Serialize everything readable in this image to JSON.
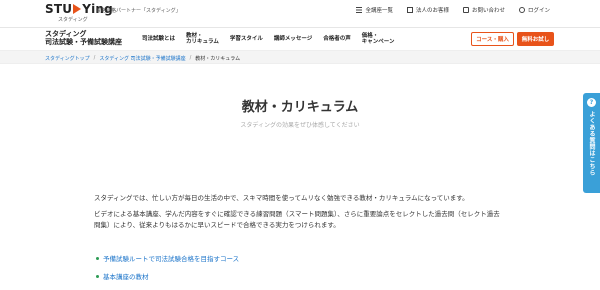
{
  "header": {
    "logo": "STUDYing",
    "logo_sub": "スタディング",
    "tagline": "資格合格パートナー「スタディング」",
    "links": [
      {
        "label": "全講座一覧",
        "icon": "menu-icon"
      },
      {
        "label": "法人のお客様",
        "icon": "building-icon"
      },
      {
        "label": "お問い合わせ",
        "icon": "mail-icon"
      },
      {
        "label": "ログイン",
        "icon": "user-icon"
      }
    ]
  },
  "nav": {
    "brand_line1": "スタディング",
    "brand_line2": "司法試験・予備試験講座",
    "items": [
      "司法試験とは",
      "教材・\nカリキュラム",
      "学習スタイル",
      "講師メッセージ",
      "合格者の声",
      "価格・\nキャンペーン"
    ],
    "course_button": "コース・購入",
    "free_button": "無料お試し"
  },
  "breadcrumb": {
    "items": [
      "スタディングトップ",
      "スタディング 司法試験・予備試験講座",
      "教材・カリキュラム"
    ]
  },
  "hero": {
    "title": "教材・カリキュラム",
    "subtitle": "スタディングの効果をぜひ体感してください"
  },
  "body": {
    "para1": "スタディングでは、忙しい方が毎日の生活の中で、スキマ時間を使ってムリなく勉強できる教材・カリキュラムになっています。",
    "para2": "ビデオによる基本講座、学んだ内容をすぐに確認できる練習問題（スマート問題集）、さらに重要論点をセレクトした過去問（セレクト過去問集）により、従来よりもはるかに早いスピードで合格できる実力をつけられます。",
    "links": [
      "予備試験ルートで司法試験合格を目指すコース",
      "基本講座の教材"
    ]
  },
  "side_tab": {
    "label": "よくある質問はこちら",
    "icon": "question-icon"
  },
  "colors": {
    "accent": "#e8531a",
    "link": "#1a73c9",
    "side_tab": "#3aa0d8"
  }
}
